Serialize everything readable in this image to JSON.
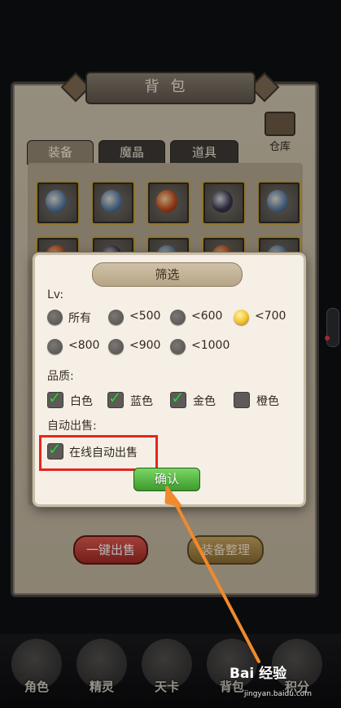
{
  "bag": {
    "title": "背包",
    "tabs": [
      "装备",
      "魔晶",
      "道具"
    ],
    "storage_label": "仓库",
    "sell_all_label": "一键出售",
    "sort_label": "装备整理"
  },
  "filter_dialog": {
    "title": "筛选",
    "level_label": "Lv:",
    "level_options": [
      "所有",
      "<500",
      "<600",
      "<700",
      "<800",
      "<900",
      "<1000"
    ],
    "level_selected": "<700",
    "quality_label": "品质:",
    "quality_options": [
      {
        "label": "白色",
        "checked": true
      },
      {
        "label": "蓝色",
        "checked": true
      },
      {
        "label": "金色",
        "checked": true
      },
      {
        "label": "橙色",
        "checked": false
      }
    ],
    "auto_sell_label": "自动出售:",
    "auto_sell_option": {
      "label": "在线自动出售",
      "checked": true
    },
    "confirm_label": "确认"
  },
  "bottom_nav": [
    "角色",
    "精灵",
    "天卡",
    "背包",
    "积分"
  ],
  "watermark": {
    "brand": "Bai 经验",
    "url": "jingyan.baidu.com"
  },
  "colors": {
    "highlight": "#e5261c",
    "arrow": "#f08a2c",
    "check": "#2fd23a",
    "confirm": "#4fb83a"
  }
}
